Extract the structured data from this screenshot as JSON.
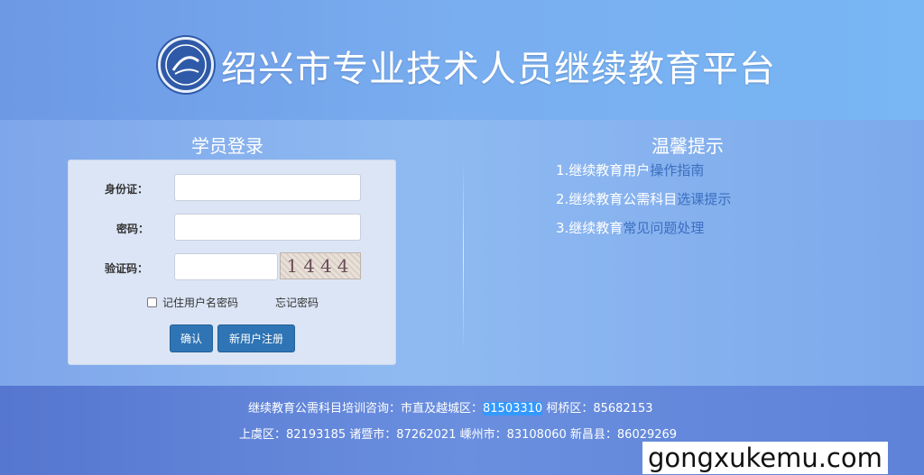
{
  "header": {
    "title": "绍兴市专业技术人员继续教育平台"
  },
  "login": {
    "title": "学员登录",
    "id_label": "身份证：",
    "password_label": "密码：",
    "captcha_label": "验证码：",
    "captcha_text": "1444",
    "remember_label": "记住用户名密码",
    "forgot_label": "忘记密码",
    "confirm_label": "确认",
    "register_label": "新用户注册"
  },
  "tips": {
    "title": "温馨提示",
    "items": [
      {
        "prefix": "1.继续教育用户",
        "link": "操作指南"
      },
      {
        "prefix": "2.继续教育公需科目",
        "link": "选课提示"
      },
      {
        "prefix": "3.继续教育",
        "link": "常见问题处理"
      }
    ]
  },
  "footer": {
    "line1_prefix": "继续教育公需科目培训咨询：市直及越城区：",
    "line1_highlight": "81503310",
    "line1_suffix": " 柯桥区：85682153",
    "line2": "上虞区：82193185 诸暨市：87262021 嵊州市：83108060 新昌县：86029269"
  },
  "watermark": "gongxukemu.com"
}
